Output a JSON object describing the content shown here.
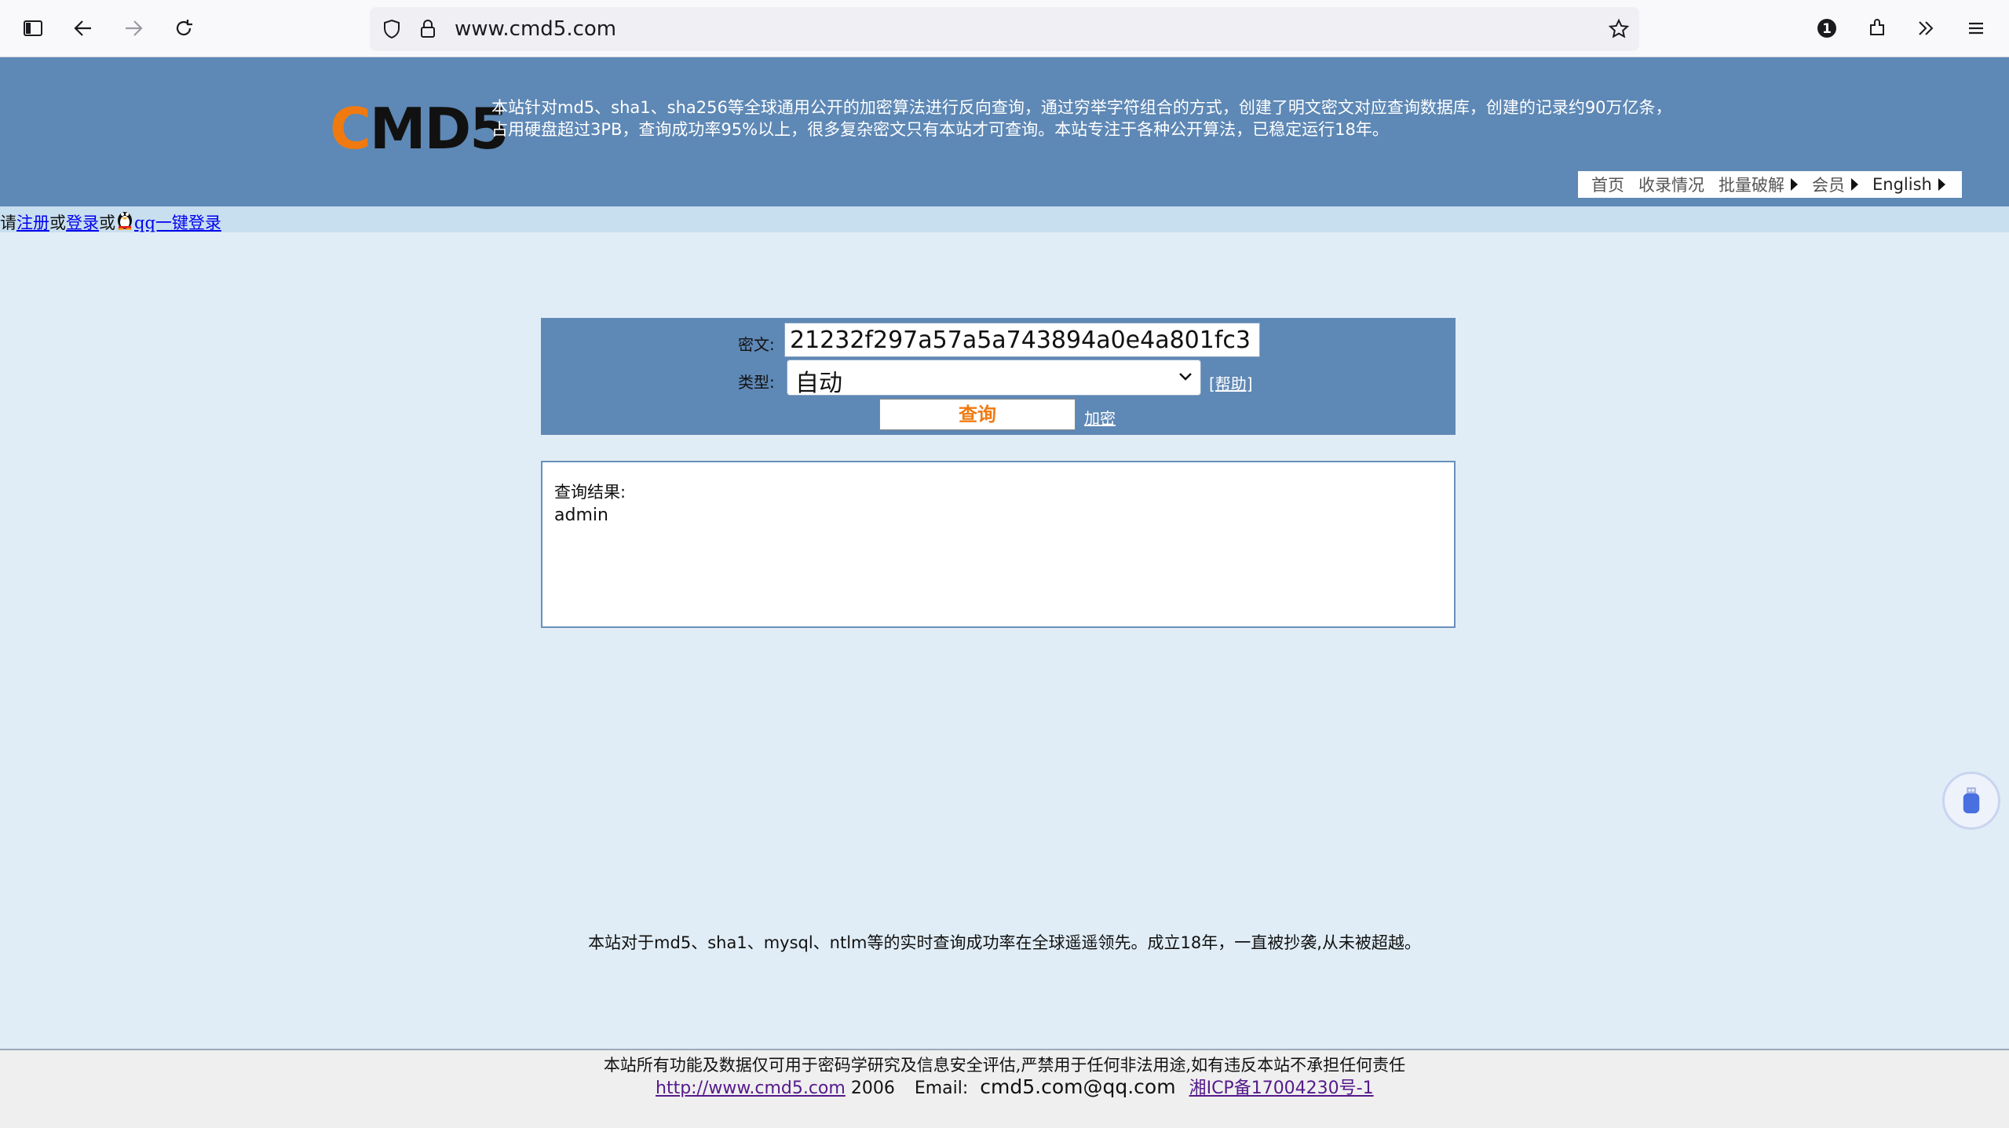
{
  "browser": {
    "url": "www.cmd5.com",
    "badge_count": "1",
    "icons": [
      "sidebar-icon",
      "back-icon",
      "forward-icon",
      "reload-icon",
      "shield-icon",
      "lock-icon",
      "bookmark-star-icon",
      "password-manager-icon",
      "extensions-icon",
      "overflow-chevrons-icon",
      "menu-icon"
    ]
  },
  "header": {
    "logo_c": "C",
    "logo_rest": "MD5",
    "description_line1": "本站针对md5、sha1、sha256等全球通用公开的加密算法进行反向查询，通过穷举字符组合的方式，创建了明文密文对应查询数据库，创建的记录约90万亿条，",
    "description_line2": "占用硬盘超过3PB，查询成功率95%以上，很多复杂密文只有本站才可查询。本站专注于各种公开算法，已稳定运行18年。",
    "nav": {
      "home": "首页",
      "records": "收录情况",
      "batch": "批量破解",
      "member": "会员",
      "english": "English"
    }
  },
  "login": {
    "prefix": "请",
    "register": "注册",
    "or1": "或",
    "signin": "登录",
    "or2": "或",
    "qq_login": "qq一键登录"
  },
  "form": {
    "cipher_label": "密文:",
    "cipher_value": "21232f297a57a5a743894a0e4a801fc3",
    "type_label": "类型:",
    "type_value": "自动",
    "help_link": "[帮助]",
    "query_button": "查询",
    "encrypt_link": "加密"
  },
  "result": {
    "label": "查询结果:",
    "value": "admin"
  },
  "tagline": "本站对于md5、sha1、mysql、ntlm等的实时查询成功率在全球遥遥领先。成立18年，一直被抄袭,从未被超越。",
  "footer": {
    "disclaimer": "本站所有功能及数据仅可用于密码学研究及信息安全评估,严禁用于任何非法用途,如有违反本站不承担任何责任",
    "site_link": "http://www.cmd5.com",
    "year": "2006",
    "email_label": "Email:",
    "email": "cmd5.com@qq.com",
    "icp": "湘ICP备17004230号-1"
  },
  "colors": {
    "banner": "#5e88b5",
    "page_bg": "#e0edf6",
    "login_strip": "#c8dff0",
    "accent_orange": "#f07a10",
    "link_blue": "#0000ee",
    "visited_purple": "#551a8b"
  }
}
